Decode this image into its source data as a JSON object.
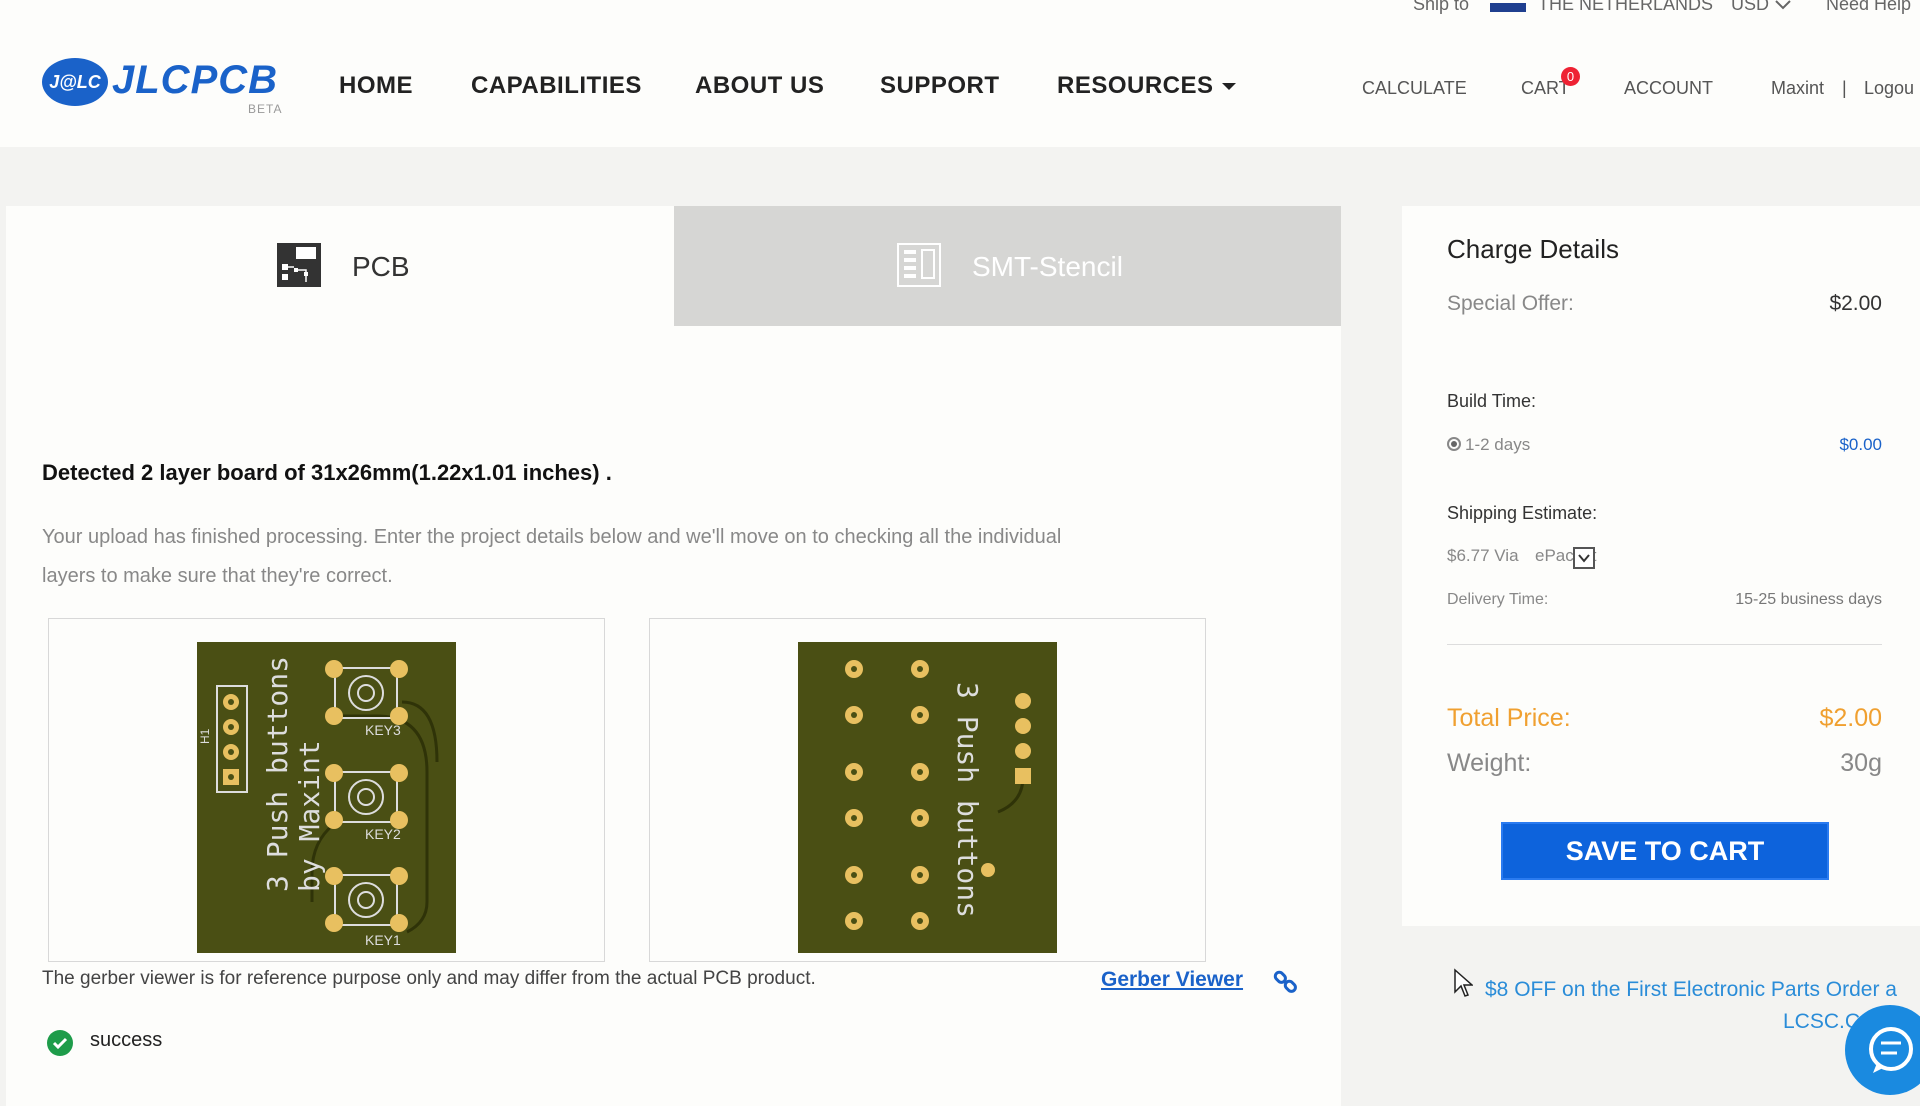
{
  "topbar": {
    "ship_to_label": "Ship to",
    "country": "THE NETHERLANDS",
    "currency": "USD",
    "help": "Need Help"
  },
  "logo": {
    "badge": "J@LC",
    "text": "JLCPCB",
    "beta": "BETA"
  },
  "nav": {
    "home": "HOME",
    "capabilities": "CAPABILITIES",
    "about": "ABOUT US",
    "support": "SUPPORT",
    "resources": "RESOURCES"
  },
  "right_nav": {
    "calculate": "CALCULATE",
    "cart": "CART",
    "cart_count": "0",
    "account": "ACCOUNT",
    "user": "Maxint",
    "separator": "|",
    "logout": "Logou"
  },
  "tabs": {
    "pcb": "PCB",
    "smt": "SMT-Stencil"
  },
  "main": {
    "detected": "Detected 2 layer board of 31x26mm(1.22x1.01 inches) .",
    "description": "Your upload has finished processing. Enter the project details below and we'll move on to checking all the individual layers to make sure that they're correct.",
    "note": "The gerber viewer is for reference purpose only and may differ from the actual PCB product.",
    "gerber_viewer": "Gerber Viewer",
    "status": "success"
  },
  "pcb_front": {
    "label1": "3 Push buttons",
    "label2": "by Maxint",
    "key3": "KEY3",
    "key2": "KEY2",
    "key1": "KEY1",
    "header": "H1"
  },
  "pcb_back": {
    "label": "3 Push buttons"
  },
  "charge": {
    "title": "Charge Details",
    "special_offer_label": "Special Offer:",
    "special_offer_value": "$2.00",
    "build_time_label": "Build Time:",
    "build_option": "1-2 days",
    "build_option_price": "$0.00",
    "shipping_label": "Shipping Estimate:",
    "shipping_price": "$6.77 Via",
    "shipping_method": "ePacket",
    "delivery_label": "Delivery Time:",
    "delivery_value": "15-25 business days",
    "total_label": "Total Price:",
    "total_value": "$2.00",
    "weight_label": "Weight:",
    "weight_value": "30g",
    "save_button": "SAVE TO CART"
  },
  "promo": {
    "line1": "$8 OFF on the First Electronic Parts Order a",
    "line2": "LCSC.C"
  },
  "colors": {
    "brand_blue": "#1a62c9",
    "total_orange": "#f0a030",
    "success_green": "#1e9c4a",
    "pcb_green": "#4a4f14",
    "pad_gold": "#e8c060"
  }
}
